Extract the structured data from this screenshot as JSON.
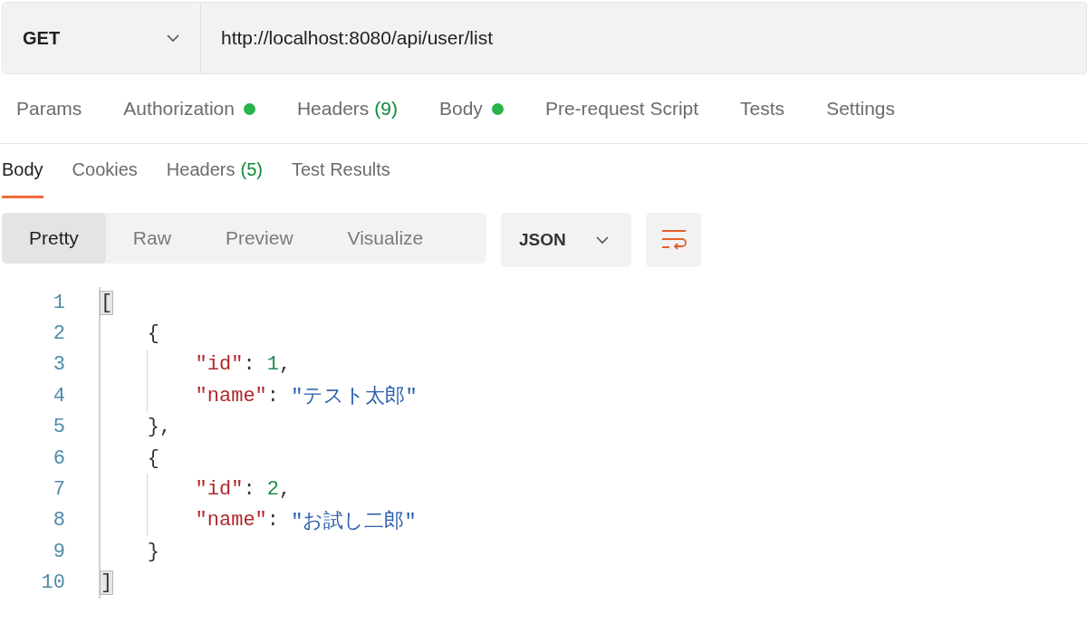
{
  "request": {
    "method": "GET",
    "url": "http://localhost:8080/api/user/list"
  },
  "request_tabs": [
    {
      "label": "Params",
      "dot": false,
      "selected": false
    },
    {
      "label": "Authorization",
      "dot": true,
      "selected": false
    },
    {
      "label": "Headers",
      "count": "(9)",
      "dot": false,
      "selected": false
    },
    {
      "label": "Body",
      "dot": true,
      "selected": false
    },
    {
      "label": "Pre-request Script",
      "dot": false,
      "selected": false
    },
    {
      "label": "Tests",
      "dot": false,
      "selected": false
    },
    {
      "label": "Settings",
      "dot": false,
      "selected": false
    }
  ],
  "response_tabs": [
    {
      "label": "Body",
      "selected": true
    },
    {
      "label": "Cookies",
      "selected": false
    },
    {
      "label": "Headers",
      "count": "(5)",
      "selected": false
    },
    {
      "label": "Test Results",
      "selected": false
    }
  ],
  "view_modes": [
    {
      "label": "Pretty",
      "selected": true
    },
    {
      "label": "Raw",
      "selected": false
    },
    {
      "label": "Preview",
      "selected": false
    },
    {
      "label": "Visualize",
      "selected": false
    }
  ],
  "format": "JSON",
  "code_lines": [
    {
      "number": "1",
      "tokens": [
        {
          "kind": "punct",
          "text": "[",
          "matched": true
        }
      ]
    },
    {
      "number": "2",
      "tokens": [
        {
          "kind": "punct",
          "text": "    {",
          "matched": false
        }
      ]
    },
    {
      "number": "3",
      "tokens": [
        {
          "kind": "key",
          "text": "        \"id\"",
          "matched": false
        },
        {
          "kind": "punct",
          "text": ": ",
          "matched": false
        },
        {
          "kind": "number",
          "text": "1",
          "matched": false
        },
        {
          "kind": "punct",
          "text": ",",
          "matched": false
        }
      ]
    },
    {
      "number": "4",
      "tokens": [
        {
          "kind": "key",
          "text": "        \"name\"",
          "matched": false
        },
        {
          "kind": "punct",
          "text": ": ",
          "matched": false
        },
        {
          "kind": "string",
          "text": "\"テスト太郎\"",
          "matched": false
        }
      ]
    },
    {
      "number": "5",
      "tokens": [
        {
          "kind": "punct",
          "text": "    },",
          "matched": false
        }
      ]
    },
    {
      "number": "6",
      "tokens": [
        {
          "kind": "punct",
          "text": "    {",
          "matched": false
        }
      ]
    },
    {
      "number": "7",
      "tokens": [
        {
          "kind": "key",
          "text": "        \"id\"",
          "matched": false
        },
        {
          "kind": "punct",
          "text": ": ",
          "matched": false
        },
        {
          "kind": "number",
          "text": "2",
          "matched": false
        },
        {
          "kind": "punct",
          "text": ",",
          "matched": false
        }
      ]
    },
    {
      "number": "8",
      "tokens": [
        {
          "kind": "key",
          "text": "        \"name\"",
          "matched": false
        },
        {
          "kind": "punct",
          "text": ": ",
          "matched": false
        },
        {
          "kind": "string",
          "text": "\"お試し二郎\"",
          "matched": false
        }
      ]
    },
    {
      "number": "9",
      "tokens": [
        {
          "kind": "punct",
          "text": "    }",
          "matched": false
        }
      ]
    },
    {
      "number": "10",
      "tokens": [
        {
          "kind": "punct",
          "text": "]",
          "matched": true
        }
      ]
    }
  ]
}
